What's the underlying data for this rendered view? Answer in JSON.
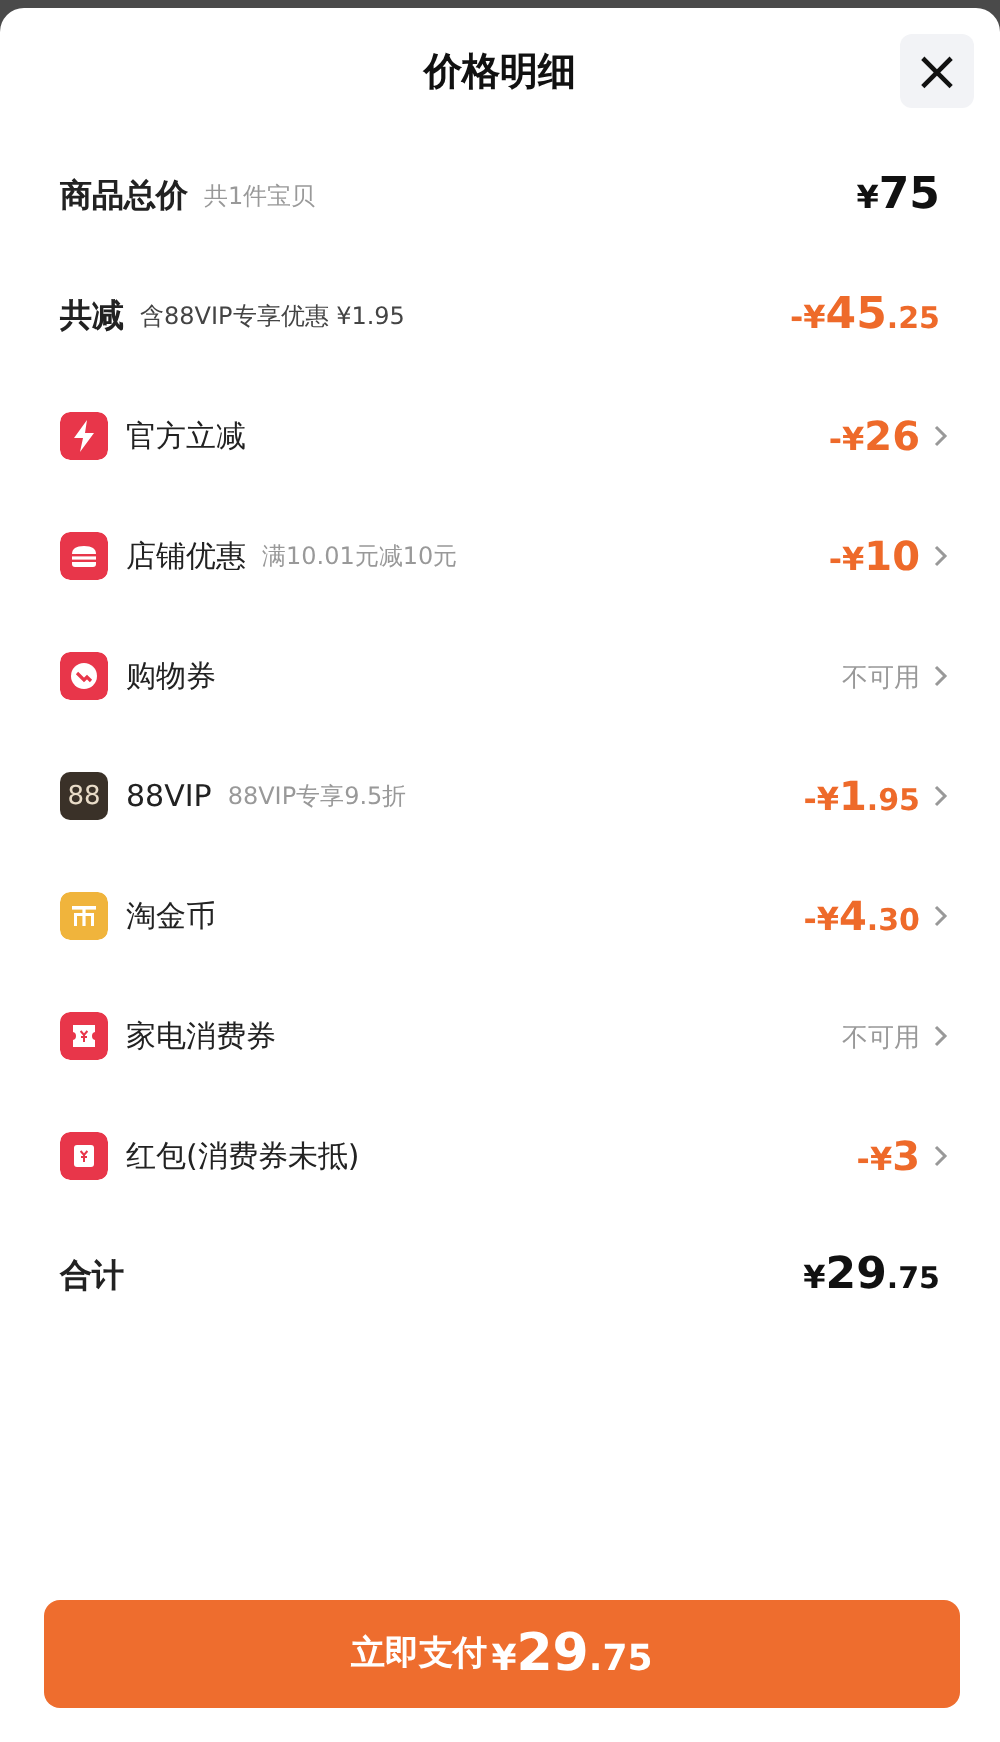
{
  "sheet": {
    "title": "价格明细",
    "close": "×"
  },
  "rows": [
    {
      "kind": "subtotal",
      "label": "商品总价",
      "note": "共1件宝贝",
      "amount": "¥75",
      "available": true
    },
    {
      "kind": "saving",
      "label": "共减",
      "note": "含88VIP专享优惠 ¥1.95",
      "amount": "-¥45.25",
      "available": true
    },
    {
      "kind": "discount",
      "color": "#e8364a",
      "label": "官方立减",
      "amount": "-¥26",
      "available": true
    },
    {
      "kind": "discount",
      "color": "#e8364a",
      "label": "店铺优惠",
      "note": "满10.01元减10元",
      "amount": "-¥10",
      "available": true
    },
    {
      "kind": "discount",
      "color": "#e8364a",
      "label": "购物券",
      "amount": "不可用",
      "available": false
    },
    {
      "kind": "discount",
      "badge": "88",
      "color": "#3a3128",
      "label": "88VIP",
      "note": "88VIP专享9.5折",
      "amount": "-¥1.95",
      "available": true
    },
    {
      "kind": "discount",
      "color": "#f0b43c",
      "label": "淘金币",
      "amount": "-¥4.30",
      "available": true
    },
    {
      "kind": "discount",
      "color": "#e8364a",
      "label": "家电消费券",
      "amount": "不可用",
      "available": false
    },
    {
      "kind": "discount",
      "color": "#e8364a",
      "label": "红包(消费券未抵)",
      "amount": "-¥3",
      "available": true
    },
    {
      "kind": "total",
      "label": "合计",
      "amount": "¥29.75",
      "available": true
    }
  ],
  "pay_button": {
    "label": "立即支付",
    "amount": "¥29.75"
  }
}
